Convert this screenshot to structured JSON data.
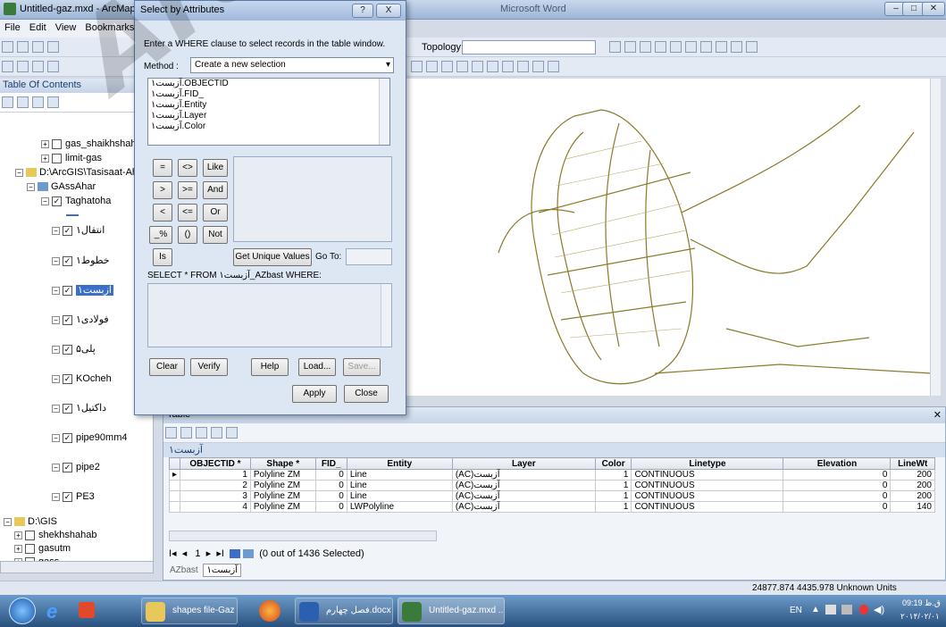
{
  "window": {
    "title": "Untitled-gaz.mxd - ArcMap - A",
    "bg_title": "Microsoft Word"
  },
  "menu": [
    "File",
    "Edit",
    "View",
    "Bookmarks"
  ],
  "toolbar": {
    "topology_label": "Topology:"
  },
  "toc": {
    "title": "Table Of Contents",
    "items": [
      {
        "label": "gas_shaikhshahab",
        "checked": false,
        "expand": "+"
      },
      {
        "label": "limit-gas",
        "checked": false,
        "expand": "+"
      },
      {
        "label": "D:\\ArcGIS\\Tasisaat-Ahi",
        "expand": "-"
      },
      {
        "label": "GAssAhar",
        "expand": "-"
      },
      {
        "label": "Taghatoha",
        "checked": true,
        "expand": "-"
      },
      {
        "label": "انتقال۱",
        "checked": true,
        "expand": "-"
      },
      {
        "label": "خطوط۱",
        "checked": true,
        "expand": "-"
      },
      {
        "label": "آزبست۱",
        "checked": true,
        "expand": "-",
        "selected": true
      },
      {
        "label": "فولادی۱",
        "checked": true,
        "expand": "-"
      },
      {
        "label": "پلی۵",
        "checked": true,
        "expand": "-"
      },
      {
        "label": "KOcheh",
        "checked": true,
        "expand": "-"
      },
      {
        "label": "داکتیل۱",
        "checked": true,
        "expand": "-"
      },
      {
        "label": "pipe90mm4",
        "checked": true,
        "expand": "-"
      },
      {
        "label": "pipe2",
        "checked": true,
        "expand": "-"
      },
      {
        "label": "PE3",
        "checked": true,
        "expand": "-"
      },
      {
        "label": "D:\\GIS",
        "expand": "-"
      },
      {
        "label": "shekhshahab",
        "checked": false,
        "expand": "+"
      },
      {
        "label": "gasutm",
        "checked": false,
        "expand": "+"
      },
      {
        "label": "gass",
        "checked": false,
        "expand": "+"
      }
    ]
  },
  "dialog": {
    "title": "Select by Attributes",
    "help_btn": "?",
    "close_btn": "X",
    "instruction": "Enter a WHERE clause to select records in the table window.",
    "method_label": "Method :",
    "method_value": "Create a new selection",
    "fields": [
      "آزبست۱.OBJECTID",
      "آزبست۱.FID_",
      "آزبست۱.Entity",
      "آزبست۱.Layer",
      "آزبست۱.Color"
    ],
    "ops": [
      "=",
      "<>",
      "Like",
      ">",
      ">=",
      "And",
      "<",
      "<=",
      "Or",
      "_%",
      "()",
      "Not",
      "Is"
    ],
    "get_unique": "Get Unique Values",
    "go_to": "Go To:",
    "sql_prefix": "SELECT * FROM آزبست۱_AZbast WHERE:",
    "buttons": {
      "clear": "Clear",
      "verify": "Verify",
      "help": "Help",
      "load": "Load...",
      "save": "Save...",
      "apply": "Apply",
      "close": "Close"
    }
  },
  "table": {
    "window_title": "Table",
    "tab_title": "آزبست۱",
    "columns": [
      "OBJECTID *",
      "Shape *",
      "FID_",
      "Entity",
      "Layer",
      "Color",
      "Linetype",
      "Elevation",
      "LineWt"
    ],
    "rows": [
      [
        "1",
        "Polyline ZM",
        "0",
        "Line",
        "(AC)آزبست",
        "1",
        "CONTINUOUS",
        "0",
        "200"
      ],
      [
        "2",
        "Polyline ZM",
        "0",
        "Line",
        "(AC)آزبست",
        "1",
        "CONTINUOUS",
        "0",
        "200"
      ],
      [
        "3",
        "Polyline ZM",
        "0",
        "Line",
        "(AC)آزبست",
        "1",
        "CONTINUOUS",
        "0",
        "200"
      ],
      [
        "4",
        "Polyline ZM",
        "0",
        "LWPolyline",
        "(AC)آزبست",
        "1",
        "CONTINUOUS",
        "0",
        "140"
      ]
    ],
    "record": "1",
    "selected_info": "(0 out of 1436 Selected)",
    "bottom_tabs": [
      "AZbast",
      "آزبست۱"
    ]
  },
  "status": {
    "coords": "24877.874  4435.978 Unknown Units"
  },
  "taskbar": {
    "items": [
      "shapes file-Gaz",
      "فصل چهارم.docx - ...",
      "Untitled-gaz.mxd ..."
    ],
    "lang": "EN",
    "time": "09:19 ق.ظ",
    "date": "۲۰۱۴/۰۲/۰۱"
  },
  "watermark": "Archive of SID",
  "colors": {
    "map_lines": "#8a7a2a",
    "selection": "#3a6ec8",
    "taskbar": "#28507f"
  }
}
